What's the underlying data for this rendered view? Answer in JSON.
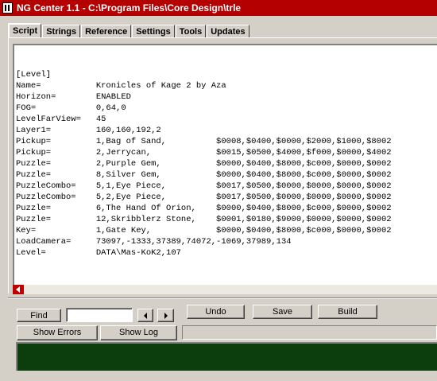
{
  "window": {
    "title": "NG Center 1.1 - C:\\Program Files\\Core Design\\trle"
  },
  "tabs": [
    {
      "label": "Script",
      "active": true
    },
    {
      "label": "Strings",
      "active": false
    },
    {
      "label": "Reference",
      "active": false
    },
    {
      "label": "Settings",
      "active": false
    },
    {
      "label": "Tools",
      "active": false
    },
    {
      "label": "Updates",
      "active": false
    }
  ],
  "script_lines": [
    "[Level]",
    "Name=           Kronicles of Kage 2 by Aza",
    "Horizon=        ENABLED",
    "FOG=            0,64,0",
    "LevelFarView=   45",
    "Layer1=         160,160,192,2",
    "Pickup=         1,Bag of Sand,          $0008,$0400,$0000,$2000,$1000,$8002",
    "Pickup=         2,Jerrycan,             $0015,$0500,$4000,$f000,$0000,$4002",
    "Puzzle=         2,Purple Gem,           $0000,$0400,$8000,$c000,$0000,$0002",
    "Puzzle=         8,Silver Gem,           $0000,$0400,$8000,$c000,$0000,$0002",
    "PuzzleCombo=    5,1,Eye Piece,          $0017,$0500,$0000,$0000,$0000,$0002",
    "PuzzleCombo=    5,2,Eye Piece,          $0017,$0500,$0000,$0000,$0000,$0002",
    "Puzzle=         6,The Hand Of Orion,    $0000,$0400,$8000,$c000,$0000,$0002",
    "Puzzle=         12,Skribblerz Stone,    $0001,$0180,$9000,$0000,$0000,$0002",
    "Key=            1,Gate Key,             $0000,$0400,$8000,$c000,$0000,$0002",
    "LoadCamera=     73097,-1333,37389,74072,-1069,37989,134",
    "Level=          DATA\\Mas-KoK2,107"
  ],
  "toolbar": {
    "find_label": "Find",
    "find_value": "",
    "undo_label": "Undo",
    "save_label": "Save",
    "build_label": "Build",
    "show_errors_label": "Show Errors",
    "show_log_label": "Show Log"
  },
  "colors": {
    "titlebar": "#b40000",
    "log_panel": "#0c3d0c",
    "scroll_arrow": "#c00000"
  }
}
